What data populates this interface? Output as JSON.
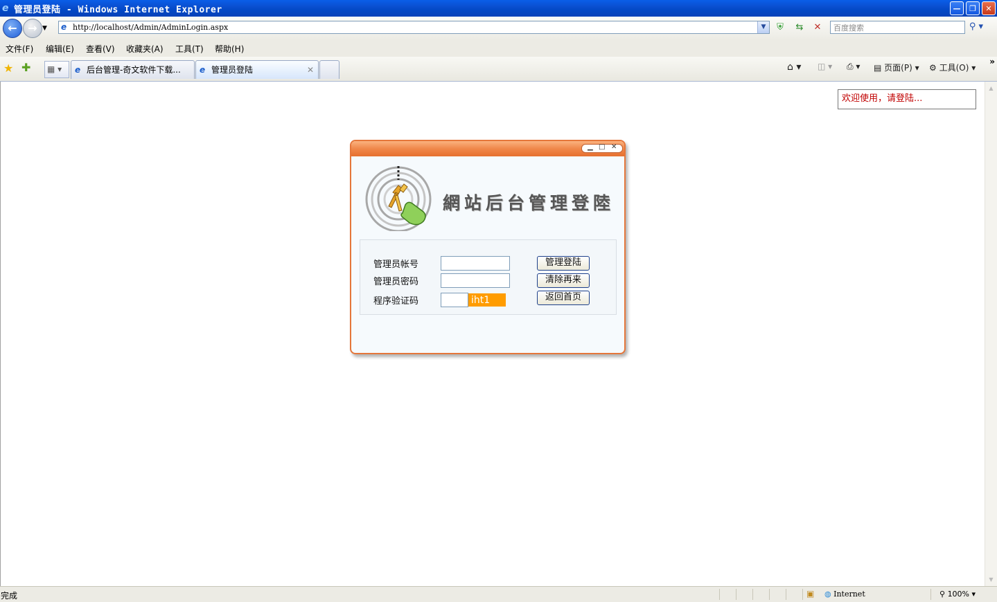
{
  "window": {
    "title": "管理员登陆 - Windows Internet Explorer",
    "minimize_glyph": "—",
    "restore_glyph": "❐",
    "close_glyph": "✕"
  },
  "address_bar": {
    "url": "http://localhost/Admin/AdminLogin.aspx",
    "search_placeholder": "百度搜索"
  },
  "menu": [
    "文件(F)",
    "编辑(E)",
    "查看(V)",
    "收藏夹(A)",
    "工具(T)",
    "帮助(H)"
  ],
  "tabs": [
    {
      "label": "后台管理-奇文软件下载..."
    },
    {
      "label": "管理员登陆"
    }
  ],
  "command_bar": {
    "page_label": "页面(P)",
    "tools_label": "工具(O)"
  },
  "page": {
    "welcome": "欢迎使用，请登陆...",
    "site_title": "網站后台管理登陸",
    "form": {
      "username_label": "管理员帐号",
      "password_label": "管理员密码",
      "captcha_label": "程序验证码",
      "captcha_value": "iht1",
      "username_value": "",
      "password_value": "",
      "captcha_input_value": ""
    },
    "buttons": {
      "login": "管理登陆",
      "clear": "清除再来",
      "home": "返回首页"
    }
  },
  "status_bar": {
    "status": "完成",
    "zone": "Internet",
    "zoom": "100%"
  },
  "colors": {
    "panel_border": "#e5763a",
    "captcha_bg": "#ff9c00",
    "welcome_text": "#c00000"
  }
}
